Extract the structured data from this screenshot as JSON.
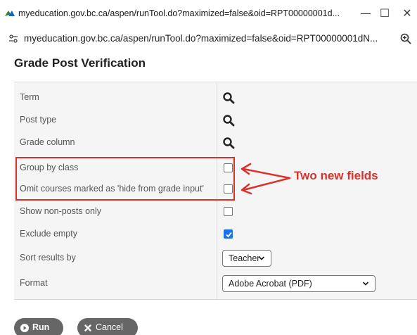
{
  "window": {
    "title": "myeducation.gov.bc.ca/aspen/runTool.do?maximized=false&oid=RPT00000001d...",
    "minimize_symbol": "—",
    "maximize_symbol": "☐",
    "close_symbol": "✕"
  },
  "address_bar": {
    "url": "myeducation.gov.bc.ca/aspen/runTool.do?maximized=false&oid=RPT00000001dN..."
  },
  "page": {
    "title": "Grade Post Verification"
  },
  "form": {
    "rows": [
      {
        "label": "Term",
        "control": "search"
      },
      {
        "label": "Post type",
        "control": "search"
      },
      {
        "label": "Grade column",
        "control": "search"
      },
      {
        "label": "Group by class",
        "control": "checkbox",
        "checked": false
      },
      {
        "label": "Omit courses marked as 'hide from grade input'",
        "control": "checkbox",
        "checked": false
      },
      {
        "label": "Show non-posts only",
        "control": "checkbox",
        "checked": false
      },
      {
        "label": "Exclude empty",
        "control": "checkbox",
        "checked": true
      },
      {
        "label": "Sort results by",
        "control": "select",
        "value": "Teacher"
      },
      {
        "label": "Format",
        "control": "select",
        "value": "Adobe Acrobat (PDF)"
      }
    ]
  },
  "annotation": {
    "label": "Two new fields",
    "color": "#d7332a"
  },
  "buttons": {
    "run_label": "Run",
    "cancel_label": "Cancel"
  },
  "icons": {
    "search": "search-icon",
    "checkmark": "checkmark-icon",
    "chevron": "chevron-down-icon",
    "run": "play-circle-icon",
    "cancel": "close-icon"
  },
  "colors": {
    "accent": "#1a73e8",
    "button_bg": "#666666",
    "panel_bg": "#f5f5f5"
  }
}
